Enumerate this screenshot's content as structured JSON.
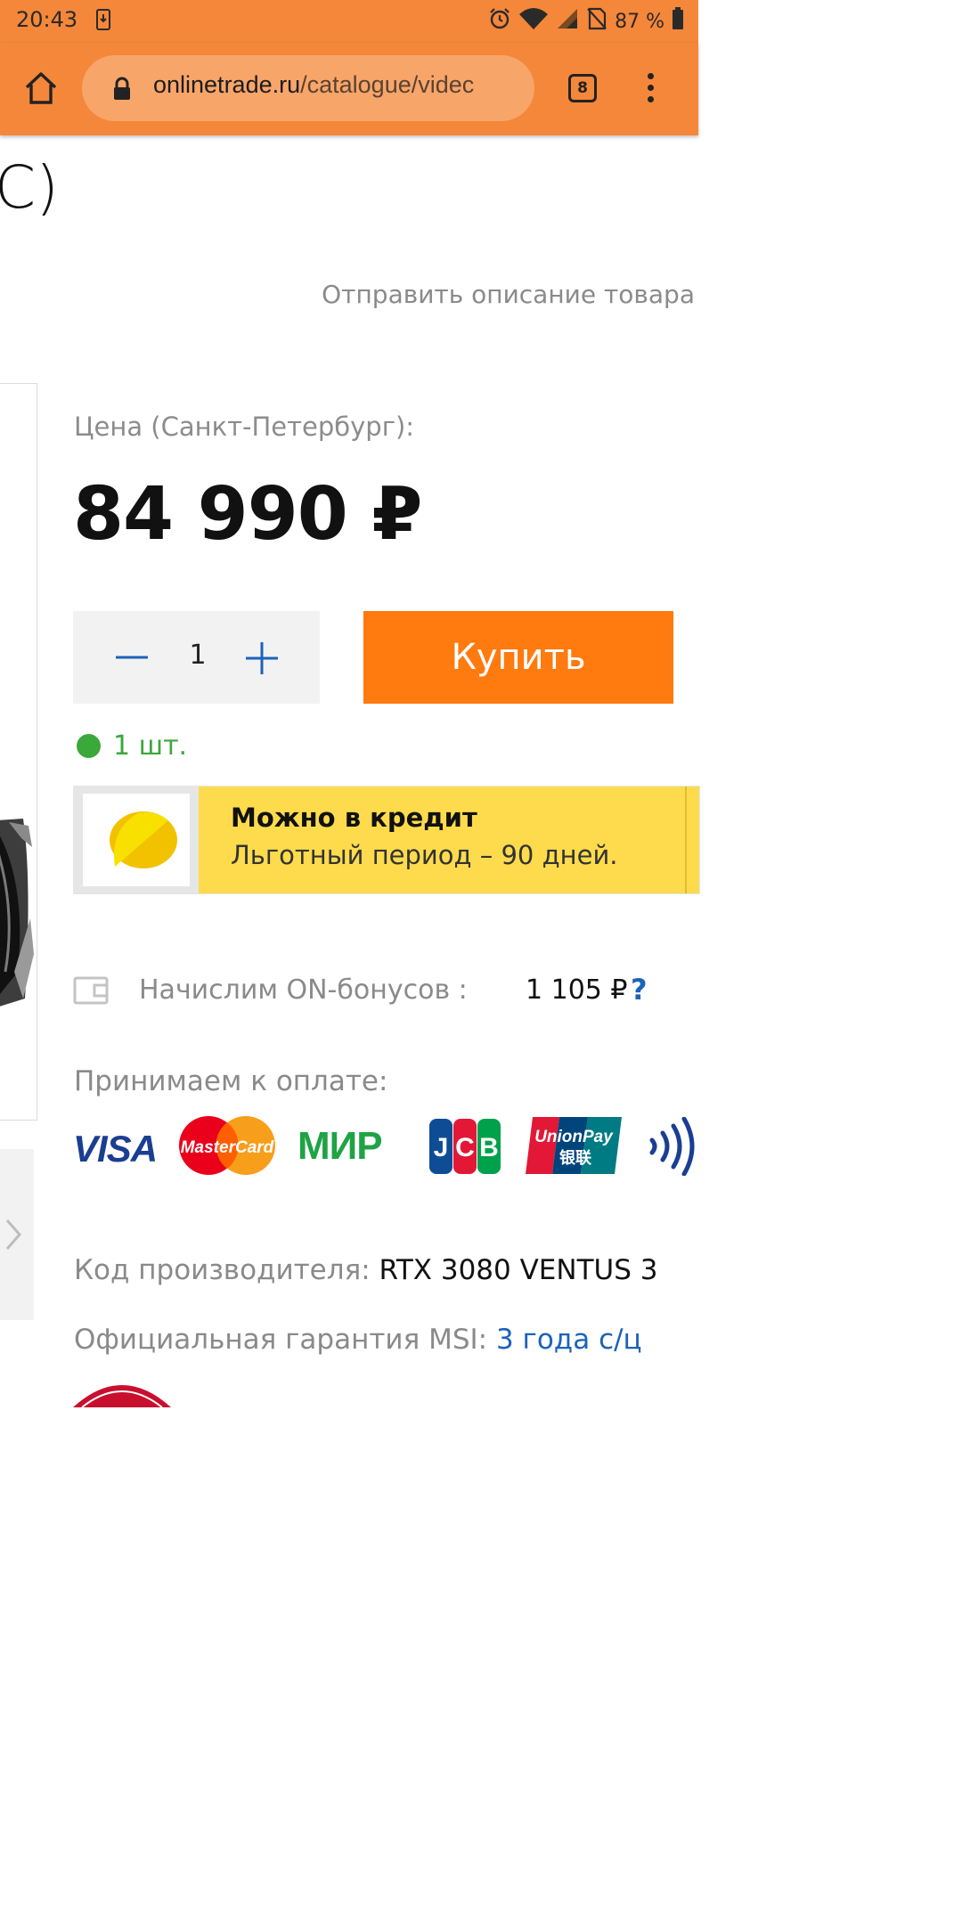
{
  "status_bar": {
    "time": "20:43",
    "battery": "87 %",
    "icons": [
      "download-icon",
      "alarm-icon",
      "wifi-icon",
      "signal-icon",
      "no-sim-icon",
      "battery-icon"
    ]
  },
  "browser": {
    "url_domain": "onlinetrade.ru",
    "url_path": "/catalogue/videc",
    "tab_count": "8",
    "toolbar_color": "#f5873a"
  },
  "product": {
    "title_fragment": "C)",
    "send_description": "Отправить описание товара",
    "price_label": "Цена (Санкт-Петербург):",
    "price": "84 990 ₽",
    "quantity": "1",
    "buy_label": "Купить",
    "stock": "1 шт.",
    "credit": {
      "title": "Можно в кредит",
      "subtitle": "Льготный период – 90 дней."
    },
    "bonus": {
      "label": "Начислим ON-бонусов :",
      "amount": "1 105 ₽",
      "help": "?"
    },
    "payment_label": "Принимаем к оплате:",
    "payment_methods": [
      "VISA",
      "MasterCard",
      "МИР",
      "JCB",
      "UnionPay",
      "NFC"
    ],
    "payment_text": {
      "visa": "VISA",
      "mastercard": "MasterCard",
      "mir": "МИР",
      "jcb": "JCB",
      "unionpay": "UnionPay",
      "unionpay_cn": "银联"
    },
    "specs": [
      {
        "label": "Код производителя:",
        "value": "RTX 3080 VENTUS 3"
      },
      {
        "label": "Официальная гарантия MSI:",
        "value": "3 года с/ц"
      }
    ]
  },
  "colors": {
    "accent": "#ff7a0f",
    "in_stock": "#3aa83a",
    "link": "#1b63b8",
    "credit_bg": "#fddb4c"
  }
}
